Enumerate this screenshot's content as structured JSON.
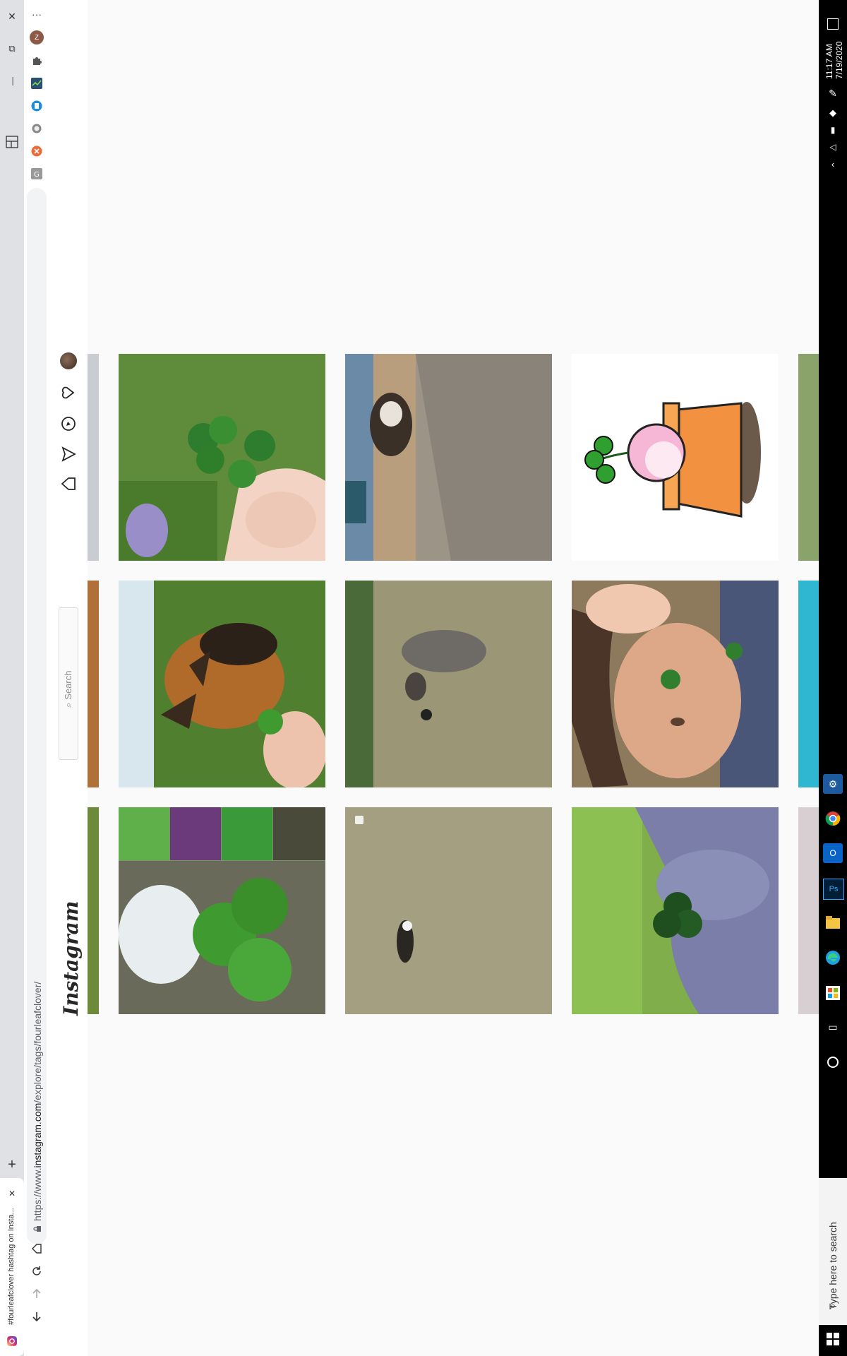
{
  "browser": {
    "tab_title": "#fourleafclover hashtag on Insta...",
    "url_prefix": "https://www.",
    "url_domain": "instagram.com",
    "url_path": "/explore/tags/fourleafclover/",
    "new_tab_label": "+",
    "tab_close_label": "✕",
    "window_controls": [
      "✕",
      "⧉",
      "—"
    ],
    "more_menu": "···",
    "profile_initial": "Z",
    "extensions": [
      "puzzle-icon",
      "chart-extension-icon",
      "blue-circle-extension-icon",
      "grey-circle-extension-icon",
      "orange-x-extension-icon",
      "grey-square-extension-icon"
    ]
  },
  "instagram": {
    "logo": "Instagram",
    "search_placeholder": "Search",
    "nav_icons": [
      "home-icon",
      "direct-icon",
      "explore-icon",
      "activity-heart-icon",
      "profile-avatar-icon"
    ]
  },
  "posts": [
    {
      "row": 1,
      "col": 1,
      "subject": "hand holding four-leaf clovers in grass"
    },
    {
      "row": 1,
      "col": 2,
      "subject": "dog on gravel beach"
    },
    {
      "row": 1,
      "col": 3,
      "subject": "cartoon clover in flower pot"
    },
    {
      "row": 2,
      "col": 1,
      "subject": "German shepherd with clover"
    },
    {
      "row": 2,
      "col": 2,
      "subject": "dog standing in lake water"
    },
    {
      "row": 2,
      "col": 3,
      "subject": "woman holding clover over eye"
    },
    {
      "row": 3,
      "col": 1,
      "subject": "clover collage"
    },
    {
      "row": 3,
      "col": 2,
      "subject": "dog swimming in lake"
    },
    {
      "row": 3,
      "col": 3,
      "subject": "fingers holding four-leaf clover"
    }
  ],
  "taskbar": {
    "time": "11:17 AM",
    "date": "7/19/2020",
    "search_placeholder": "Type here to search"
  },
  "colors": {
    "accent_blue": "#1a73e8",
    "instagram_border": "#dbdbdb",
    "taskbar": "#000000"
  }
}
